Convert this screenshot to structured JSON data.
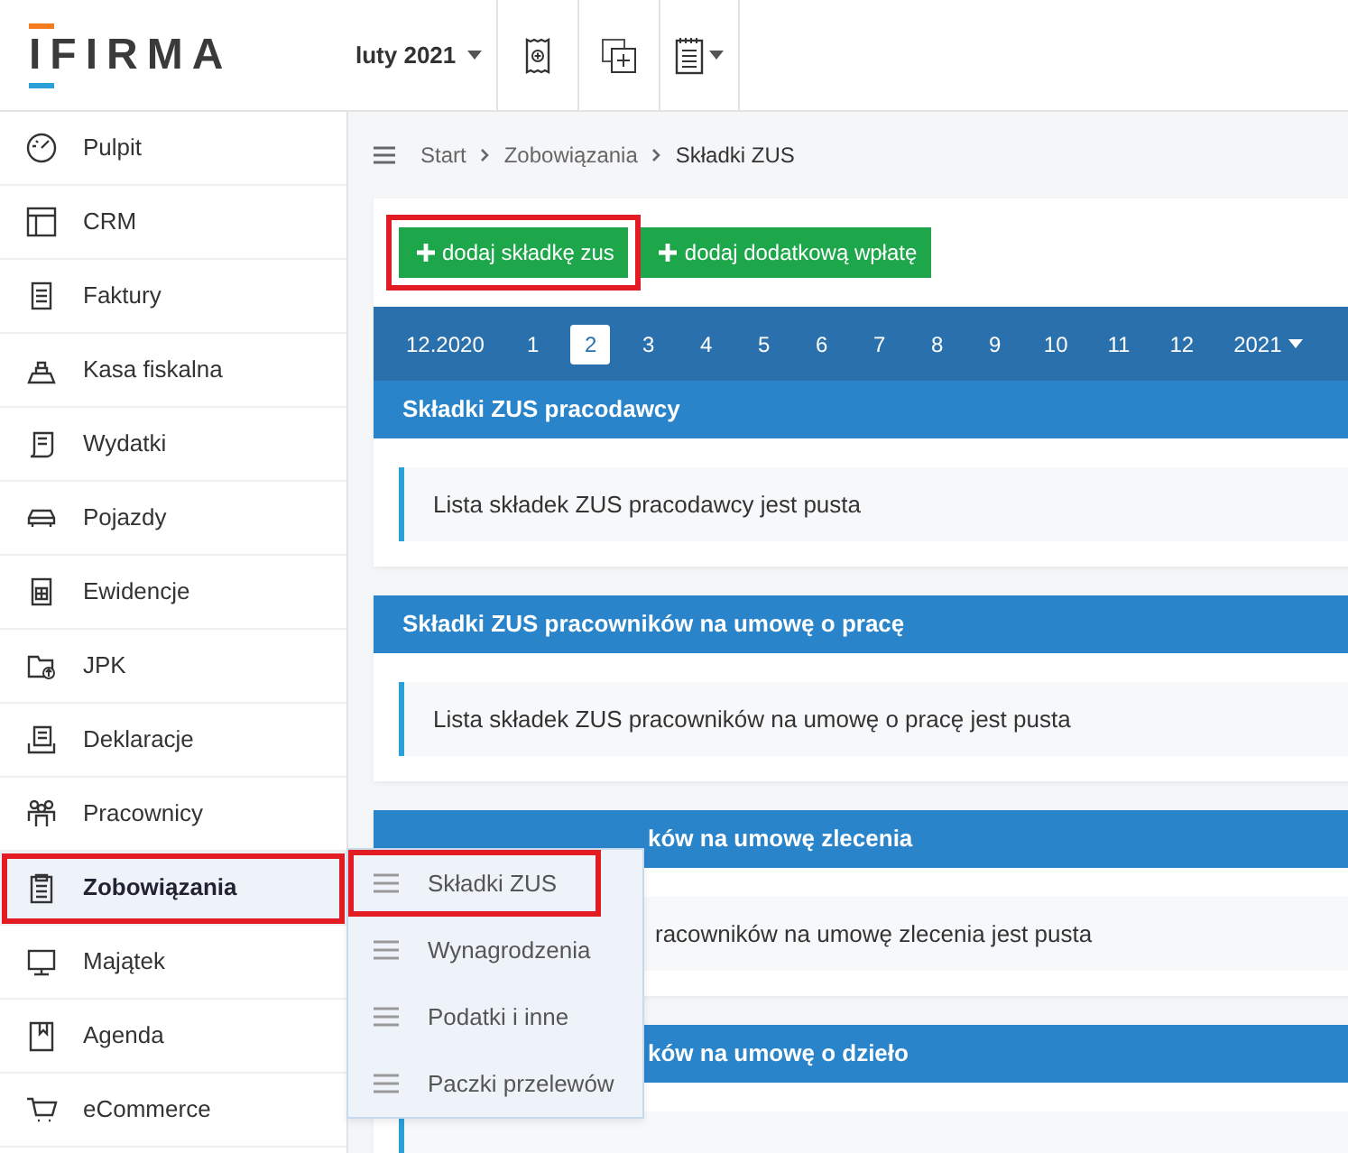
{
  "header": {
    "logo": "IFIRMA",
    "period": "luty 2021"
  },
  "sidebar": {
    "items": [
      {
        "label": "Pulpit",
        "selected": false,
        "highlighted": false
      },
      {
        "label": "CRM",
        "selected": false,
        "highlighted": false
      },
      {
        "label": "Faktury",
        "selected": false,
        "highlighted": false
      },
      {
        "label": "Kasa fiskalna",
        "selected": false,
        "highlighted": false
      },
      {
        "label": "Wydatki",
        "selected": false,
        "highlighted": false
      },
      {
        "label": "Pojazdy",
        "selected": false,
        "highlighted": false
      },
      {
        "label": "Ewidencje",
        "selected": false,
        "highlighted": false
      },
      {
        "label": "JPK",
        "selected": false,
        "highlighted": false
      },
      {
        "label": "Deklaracje",
        "selected": false,
        "highlighted": false
      },
      {
        "label": "Pracownicy",
        "selected": false,
        "highlighted": false
      },
      {
        "label": "Zobowiązania",
        "selected": true,
        "highlighted": true
      },
      {
        "label": "Majątek",
        "selected": false,
        "highlighted": false
      },
      {
        "label": "Agenda",
        "selected": false,
        "highlighted": false
      },
      {
        "label": "eCommerce",
        "selected": false,
        "highlighted": false
      }
    ]
  },
  "submenu": {
    "items": [
      {
        "label": "Składki ZUS",
        "highlighted": true
      },
      {
        "label": "Wynagrodzenia",
        "highlighted": false
      },
      {
        "label": "Podatki i inne",
        "highlighted": false
      },
      {
        "label": "Paczki przelewów",
        "highlighted": false
      }
    ]
  },
  "breadcrumb": [
    "Start",
    "Zobowiązania",
    "Składki ZUS"
  ],
  "buttons": [
    {
      "label": "dodaj składkę zus",
      "highlighted": true
    },
    {
      "label": "dodaj dodatkową wpłatę",
      "highlighted": false
    }
  ],
  "months": [
    {
      "label": "12.2020",
      "selected": false
    },
    {
      "label": "1",
      "selected": false
    },
    {
      "label": "2",
      "selected": true
    },
    {
      "label": "3",
      "selected": false
    },
    {
      "label": "4",
      "selected": false
    },
    {
      "label": "5",
      "selected": false
    },
    {
      "label": "6",
      "selected": false
    },
    {
      "label": "7",
      "selected": false
    },
    {
      "label": "8",
      "selected": false
    },
    {
      "label": "9",
      "selected": false
    },
    {
      "label": "10",
      "selected": false
    },
    {
      "label": "11",
      "selected": false
    },
    {
      "label": "12",
      "selected": false
    }
  ],
  "year": "2021",
  "sections": [
    {
      "kind": "full",
      "title": "Składki ZUS pracodawcy",
      "message": "Lista składek ZUS pracodawcy jest pusta"
    },
    {
      "kind": "full",
      "title": "Składki ZUS pracowników na umowę o pracę",
      "message": "Lista składek ZUS pracowników na umowę o pracę jest pusta"
    },
    {
      "kind": "partial",
      "title": "ków na umowę zlecenia",
      "message": "racowników na umowę zlecenia jest pusta"
    },
    {
      "kind": "partial",
      "title": "ków na umowę o dzieło"
    }
  ]
}
